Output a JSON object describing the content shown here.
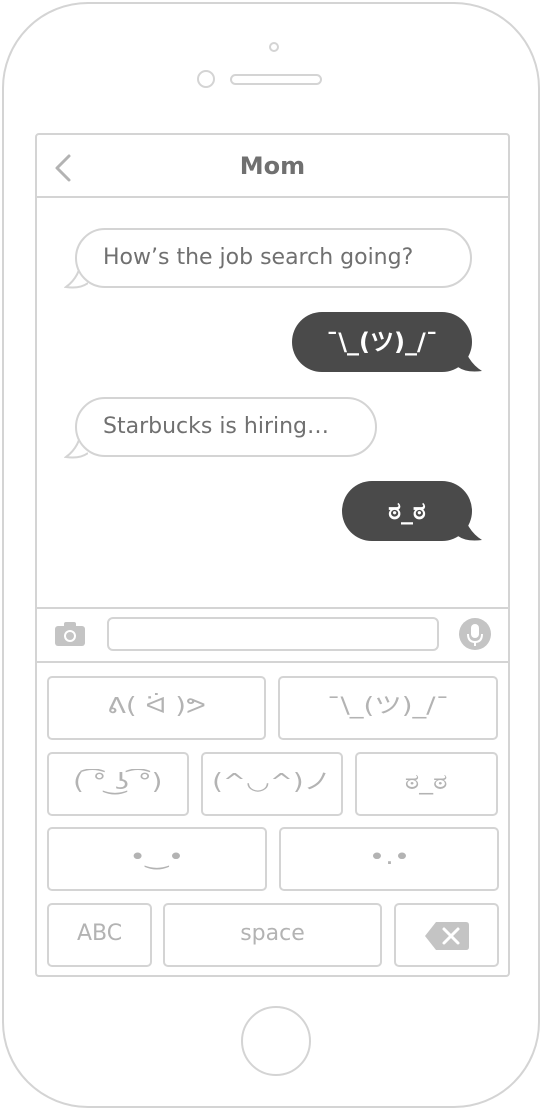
{
  "conversation": {
    "title": "Mom",
    "back_icon": "chevron-left-icon"
  },
  "messages": [
    {
      "direction": "incoming",
      "text": "How’s the job search going?"
    },
    {
      "direction": "outgoing",
      "text": "¯\\_(ツ)_/¯"
    },
    {
      "direction": "incoming",
      "text": "Starbucks is hiring…"
    },
    {
      "direction": "outgoing",
      "text": "ಠ_ಠ"
    }
  ],
  "composer": {
    "camera_icon": "camera-icon",
    "input_value": "",
    "input_placeholder": "",
    "mic_icon": "microphone-icon"
  },
  "keyboard": {
    "faces": [
      "ᕕ( ᐛ )ᕗ",
      "¯\\_(ツ)_/¯",
      "( ͡° ͜ʖ ͡°)",
      "(^◡^)ノ",
      "ಠ_ಠ",
      "•‿•",
      "•.•"
    ],
    "abc_label": "ABC",
    "space_label": "space",
    "delete_icon": "backspace-icon"
  },
  "colors": {
    "outgoing_bubble": "#4a4a4a",
    "outline": "#d4d4d4",
    "text_gray": "#707070",
    "key_text": "#b3b3b3"
  }
}
